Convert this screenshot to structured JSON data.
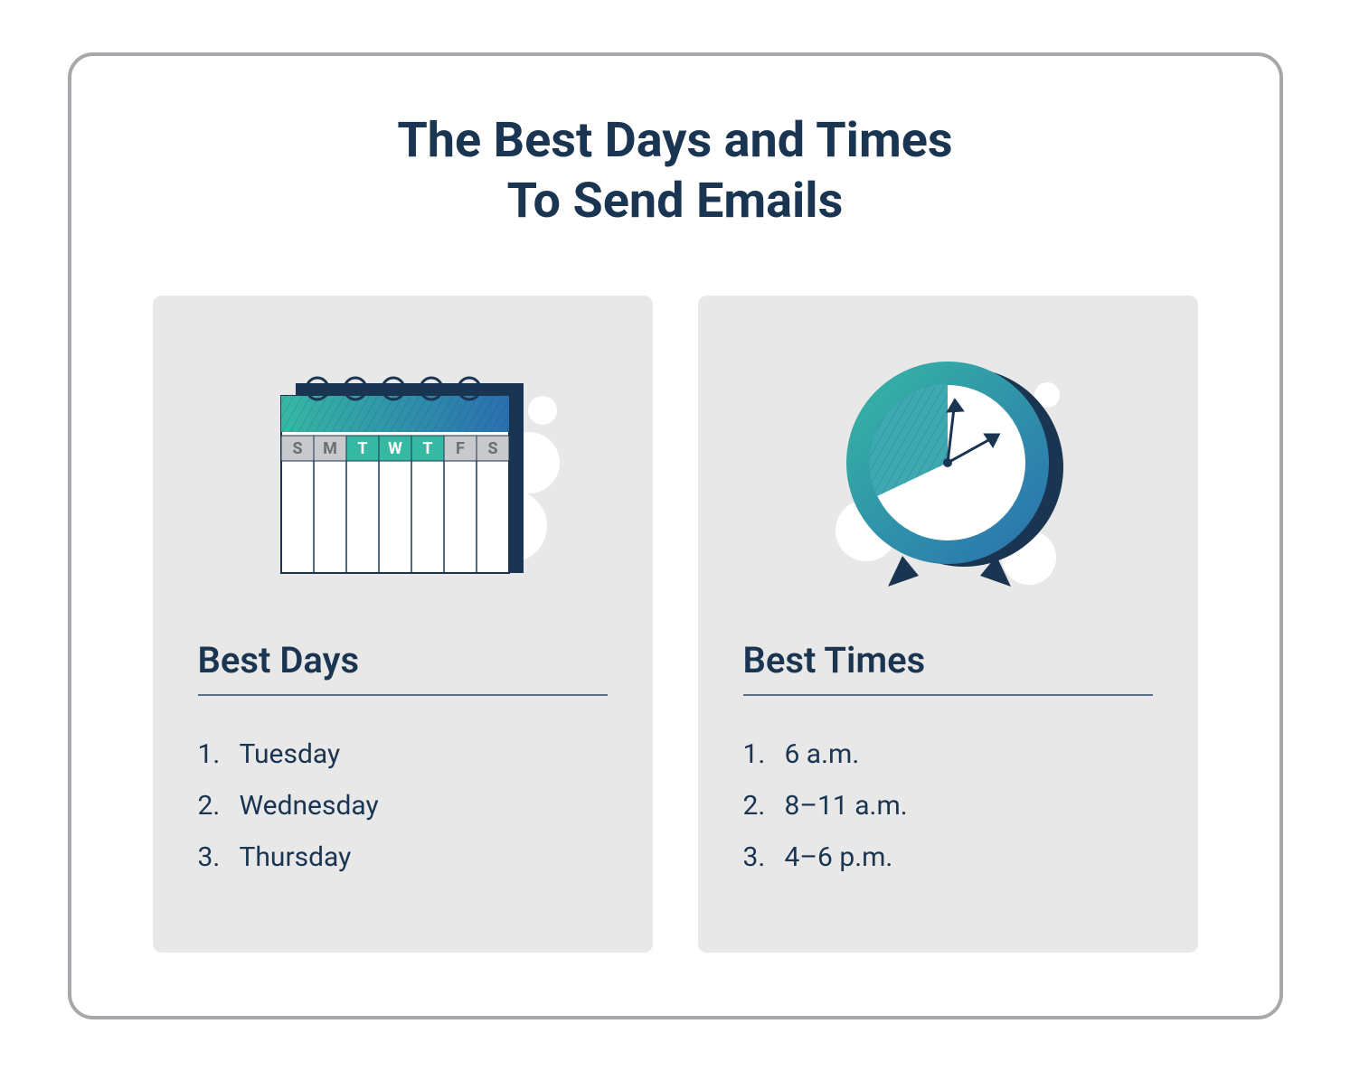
{
  "title_line1": "The Best Days and Times",
  "title_line2": "To Send Emails",
  "colors": {
    "text_dark": "#1a3552",
    "panel_bg": "#e8e8e8",
    "border": "#a6a8ab",
    "teal": "#36b8a3",
    "blue": "#2a6fb0",
    "navy": "#1a3552"
  },
  "calendar": {
    "day_initials": [
      "S",
      "M",
      "T",
      "W",
      "T",
      "F",
      "S"
    ],
    "highlighted_indices": [
      2,
      3,
      4
    ]
  },
  "panels": {
    "best_days": {
      "title": "Best Days",
      "items": [
        "Tuesday",
        "Wednesday",
        "Thursday"
      ]
    },
    "best_times": {
      "title": "Best Times",
      "items": [
        "6 a.m.",
        "8–11 a.m.",
        "4–6 p.m."
      ]
    }
  }
}
